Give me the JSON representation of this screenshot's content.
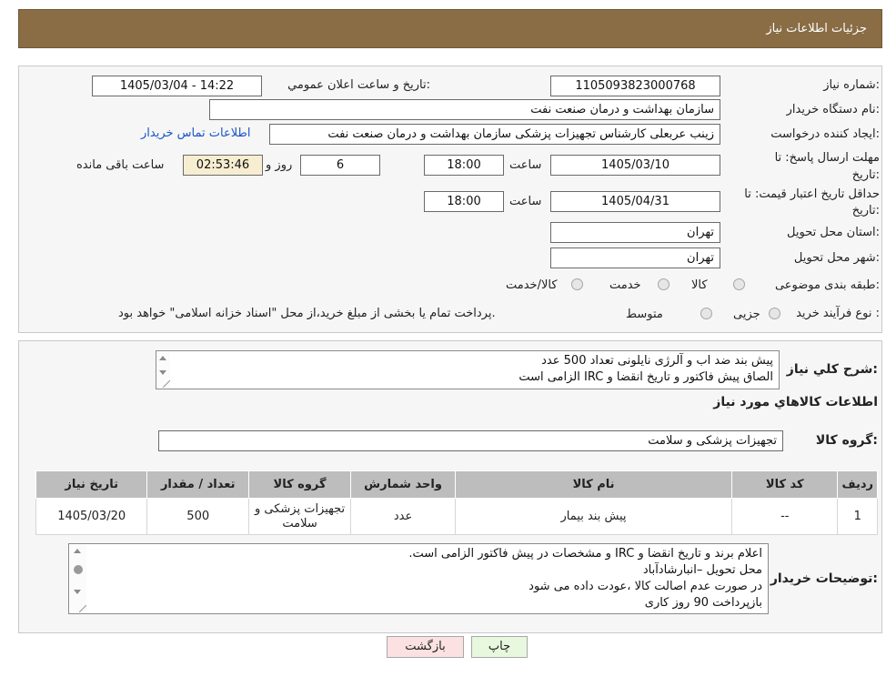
{
  "header": {
    "title": "جزئیات اطلاعات نیاز"
  },
  "form": {
    "need_number_label": "شماره نیاز:",
    "need_number": "1105093823000768",
    "announce_label": "تاریخ و ساعت اعلان عمومي:",
    "announce_value": "1405/03/04 - 14:22",
    "buyer_org_label": "نام دستگاه خریدار:",
    "buyer_org": "سازمان بهداشت و درمان صنعت نفت",
    "creator_label": "ایجاد کننده درخواست:",
    "creator": "زینب عربعلی کارشناس تجهیزات پزشکی سازمان بهداشت و درمان صنعت نفت",
    "contact_link": "اطلاعات تماس خریدار",
    "deadline_label_1": "مهلت ارسال پاسخ: تا",
    "deadline_label_2": "تاریخ:",
    "deadline_date": "1405/03/10",
    "time_label": "ساعت",
    "deadline_time": "18:00",
    "days_value": "6",
    "days_label": "روز و",
    "remaining_time": "02:53:46",
    "remaining_label": "ساعت باقی مانده",
    "validity_label_1": "حداقل تاریخ اعتبار قیمت: تا",
    "validity_label_2": "تاریخ:",
    "validity_date": "1405/04/31",
    "validity_time": "18:00",
    "province_label": "استان محل تحویل:",
    "province": "تهران",
    "city_label": "شهر محل تحویل:",
    "city": "تهران",
    "category_label": "طبقه بندی موضوعی:",
    "category_options": [
      "کالا",
      "خدمت",
      "کالا/خدمت"
    ],
    "process_label": "نوع فرآیند خرید :",
    "process_options": [
      "جزیی",
      "متوسط"
    ],
    "process_note": "پرداخت تمام یا بخشی از مبلغ خرید،از محل \"اسناد خزانه اسلامی\" خواهد بود."
  },
  "description": {
    "label": "شرح كلي نياز:",
    "lines": [
      "پیش بند ضد اب و آلرژی نایلونی تعداد   500 عدد",
      "الصاق پیش فاکتور و تاریخ انقضا و IRC  الزامی است"
    ]
  },
  "goods": {
    "section_title": "اطلاعات كالاهاي مورد نياز",
    "group_label": "گروه كالا:",
    "group_value": "تجهیزات پزشکی و سلامت",
    "columns": [
      "رديف",
      "كد كالا",
      "نام كالا",
      "واحد شمارش",
      "گروه كالا",
      "تعداد / مقدار",
      "تاريخ نياز"
    ],
    "rows": [
      {
        "row": "1",
        "code": "--",
        "name": "پیش بند بیمار",
        "unit": "عدد",
        "group": "تجهیزات پزشکی و سلامت",
        "qty": "500",
        "date": "1405/03/20"
      }
    ]
  },
  "buyer_notes": {
    "label": "توضيحات خريدار:",
    "lines": [
      "اعلام برند و تاریخ انقضا  و IRC  و مشخصات  در پیش فاکتور الزامی است.",
      "محل تحویل –انبارشادآباد",
      "در صورت عدم اصالت کالا ،عودت داده می شود",
      "بازپرداخت 90 روز کاری"
    ]
  },
  "buttons": {
    "print": "چاپ",
    "back": "بازگشت"
  },
  "colors": {
    "header": "#8a6d45",
    "timer_bg": "#f7eed1",
    "back_btn": "#fbe1e1",
    "print_btn": "#e8f8df",
    "link": "#1a55c8"
  }
}
